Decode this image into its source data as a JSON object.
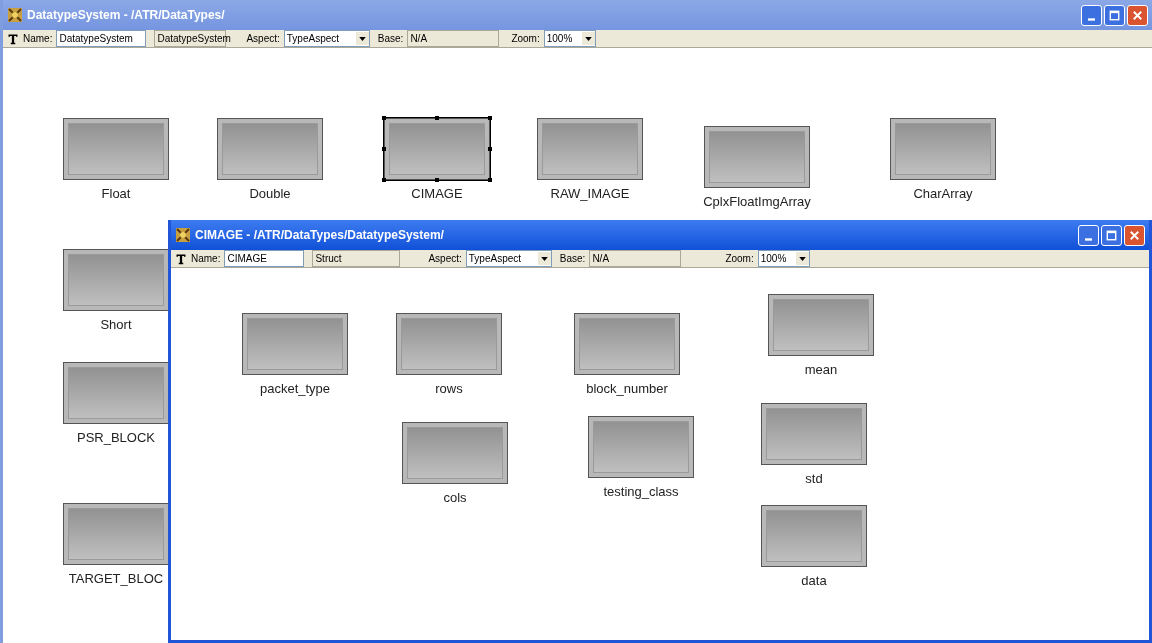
{
  "windows": [
    {
      "title": "DatatypeSystem - /ATR/DataTypes/",
      "toolbar": {
        "name_label": "Name:",
        "name": "DatatypeSystem",
        "type": "DatatypeSystem",
        "aspect_label": "Aspect:",
        "aspect": "TypeAspect",
        "base_label": "Base:",
        "base": "N/A",
        "zoom_label": "Zoom:",
        "zoom": "100%"
      },
      "nodes": [
        {
          "label": "Float",
          "selected": false
        },
        {
          "label": "Double",
          "selected": false
        },
        {
          "label": "CIMAGE",
          "selected": true
        },
        {
          "label": "RAW_IMAGE",
          "selected": false
        },
        {
          "label": "CplxFloatImgArray",
          "selected": false
        },
        {
          "label": "CharArray",
          "selected": false
        },
        {
          "label": "Short",
          "selected": false
        },
        {
          "label": "PSR_BLOCK",
          "selected": false
        },
        {
          "label": "TARGET_BLOC",
          "selected": false
        }
      ]
    },
    {
      "title": "CIMAGE - /ATR/DataTypes/DatatypeSystem/",
      "toolbar": {
        "name_label": "Name:",
        "name": "CIMAGE",
        "type": "Struct",
        "aspect_label": "Aspect:",
        "aspect": "TypeAspect",
        "base_label": "Base:",
        "base": "N/A",
        "zoom_label": "Zoom:",
        "zoom": "100%"
      },
      "nodes": [
        {
          "label": "packet_type",
          "selected": false
        },
        {
          "label": "rows",
          "selected": false
        },
        {
          "label": "block_number",
          "selected": false
        },
        {
          "label": "mean",
          "selected": false
        },
        {
          "label": "cols",
          "selected": false
        },
        {
          "label": "testing_class",
          "selected": false
        },
        {
          "label": "std",
          "selected": false
        },
        {
          "label": "data",
          "selected": false
        }
      ]
    }
  ]
}
